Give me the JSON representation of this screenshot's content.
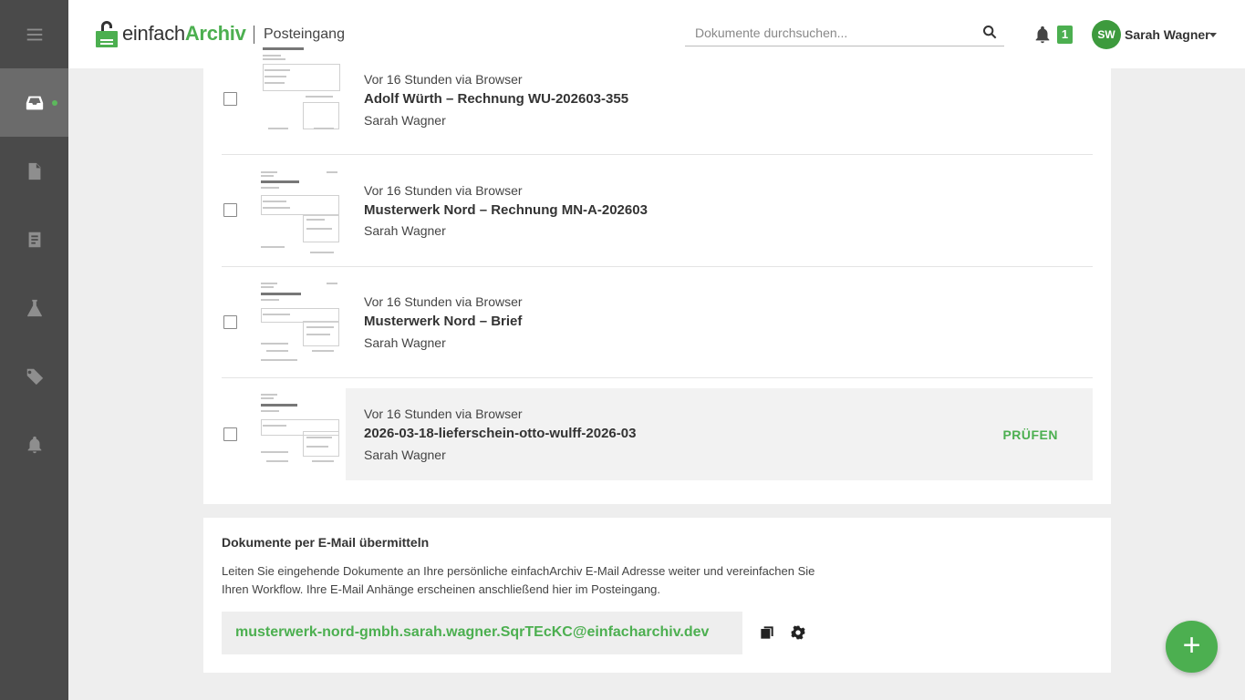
{
  "app": {
    "logo_part1": "einfach",
    "logo_part2": "Archiv",
    "section": "Posteingang",
    "brand_color": "#4caf50"
  },
  "search": {
    "placeholder": "Dokumente durchsuchen...",
    "value": "",
    "icon": "search-icon"
  },
  "notifications": {
    "count": "1",
    "icon": "bell-icon"
  },
  "user": {
    "initials": "SW",
    "name": "Sarah Wagner"
  },
  "sidebar": {
    "items": [
      {
        "name": "menu",
        "icon": "menu-icon"
      },
      {
        "name": "inbox",
        "icon": "inbox-icon",
        "active": true
      },
      {
        "name": "documents",
        "icon": "document-icon"
      },
      {
        "name": "folders",
        "icon": "folder-icon"
      },
      {
        "name": "lab",
        "icon": "flask-icon"
      },
      {
        "name": "tags",
        "icon": "tag-icon"
      },
      {
        "name": "notifications",
        "icon": "bell-icon"
      }
    ]
  },
  "documents": [
    {
      "meta": "Vor 16 Stunden via Browser",
      "title": "Adolf Würth – Rechnung WU-202603-355",
      "owner": "Sarah Wagner"
    },
    {
      "meta": "Vor 16 Stunden via Browser",
      "title": "Musterwerk Nord – Rechnung MN-A-202603",
      "owner": "Sarah Wagner"
    },
    {
      "meta": "Vor 16 Stunden via Browser",
      "title": "Musterwerk Nord – Brief",
      "owner": "Sarah Wagner"
    },
    {
      "meta": "Vor 16 Stunden via Browser",
      "title": "2026-03-18-lieferschein-otto-wulff-2026-03",
      "owner": "Sarah Wagner",
      "action": "PRÜFEN"
    }
  ],
  "email_section": {
    "title": "Dokumente per E-Mail übermitteln",
    "description": "Leiten Sie eingehende Dokumente an Ihre persönliche einfachArchiv E-Mail Adresse weiter und vereinfachen Sie Ihren Workflow. Ihre E-Mail Anhänge erscheinen anschließend hier im Posteingang.",
    "address": "musterwerk-nord-gmbh.sarah.wagner.SqrTEcKC@einfacharchiv.dev"
  },
  "fab": {
    "label": "+"
  }
}
